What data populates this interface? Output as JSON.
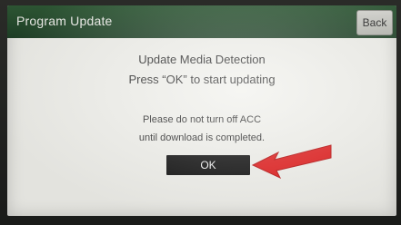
{
  "window": {
    "title": "Program Update",
    "back_label": "Back"
  },
  "dialog": {
    "line1": "Update Media Detection",
    "line2": "Press “OK” to start updating",
    "line3": "Please do not turn off ACC",
    "line4": "until download is completed.",
    "ok_label": "OK"
  },
  "colors": {
    "title_bar": "#2f5a36",
    "annotation_arrow": "#e11b1b"
  },
  "icons": {
    "annotation": "red-arrow-icon"
  }
}
